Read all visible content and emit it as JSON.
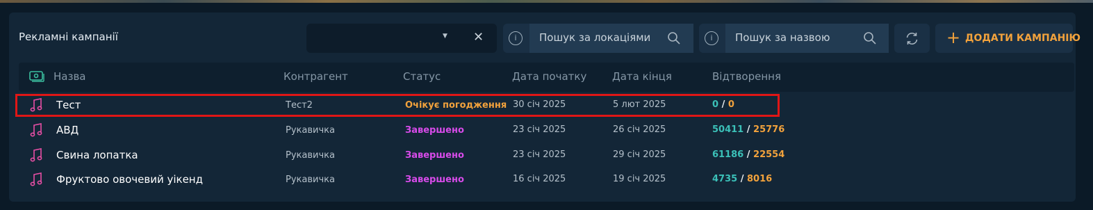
{
  "header": {
    "title": "Рекламні кампанії",
    "location_search_placeholder": "Пошук за локаціями",
    "name_search_placeholder": "Пошук за назвою",
    "add_button_label": "ДОДАТИ КАМПАНІЮ"
  },
  "columns": [
    "Назва",
    "Контрагент",
    "Статус",
    "Дата початку",
    "Дата кінця",
    "Відтворення"
  ],
  "rows": [
    {
      "name": "Тест",
      "counterparty": "Тест2",
      "status": "Очікує погодження",
      "status_color": "#f2a23c",
      "start": "30 січ 2025",
      "end": "5 лют 2025",
      "plays_a": "0",
      "plays_b": "0"
    },
    {
      "name": "АВД",
      "counterparty": "Рукавичка",
      "status": "Завершено",
      "status_color": "#d84bea",
      "start": "23 січ 2025",
      "end": "26 січ 2025",
      "plays_a": "50411",
      "plays_b": "25776"
    },
    {
      "name": "Свина лопатка",
      "counterparty": "Рукавичка",
      "status": "Завершено",
      "status_color": "#d84bea",
      "start": "23 січ 2025",
      "end": "29 січ 2025",
      "plays_a": "61186",
      "plays_b": "22554"
    },
    {
      "name": "Фруктово овочевий уікенд",
      "counterparty": "Рукавичка",
      "status": "Завершено",
      "status_color": "#d84bea",
      "start": "16 січ 2025",
      "end": "19 січ 2025",
      "plays_a": "4735",
      "plays_b": "8016"
    }
  ],
  "colors": {
    "accent": "#f2a23c",
    "completed": "#d84bea",
    "plays_primary": "#3bc0b8",
    "icon_pink": "#e84fa5",
    "icon_green": "#3bc0a0",
    "highlight": "#e01616"
  },
  "icons": {
    "row_icon": "music-note-icon",
    "name_header_icon": "money-icon",
    "search_icon": "search-icon",
    "info_icon": "info-icon",
    "refresh_icon": "refresh-icon",
    "clear_icon": "close-icon",
    "caret_icon": "caret-down-icon"
  },
  "plays_separator": "/"
}
